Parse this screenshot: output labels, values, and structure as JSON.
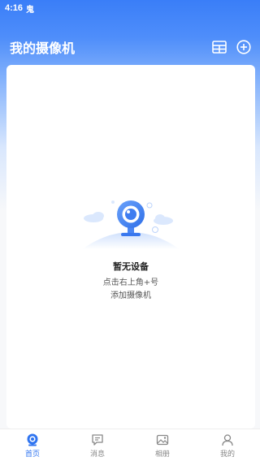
{
  "status_bar": {
    "time": "4:16",
    "notification": "鬼"
  },
  "header": {
    "title": "我的摄像机"
  },
  "empty_state": {
    "title": "暂无设备",
    "hint_line1": "点击右上角+号",
    "hint_line2": "添加摄像机"
  },
  "tabbar": {
    "tabs": [
      {
        "label": "首页",
        "icon": "home-camera-icon",
        "active": true
      },
      {
        "label": "消息",
        "icon": "message-icon",
        "active": false
      },
      {
        "label": "相册",
        "icon": "album-icon",
        "active": false
      },
      {
        "label": "我的",
        "icon": "profile-icon",
        "active": false
      }
    ]
  },
  "colors": {
    "primary": "#2f74f0",
    "header_blue": "#3a7ef8",
    "inactive_tab": "#888888"
  }
}
